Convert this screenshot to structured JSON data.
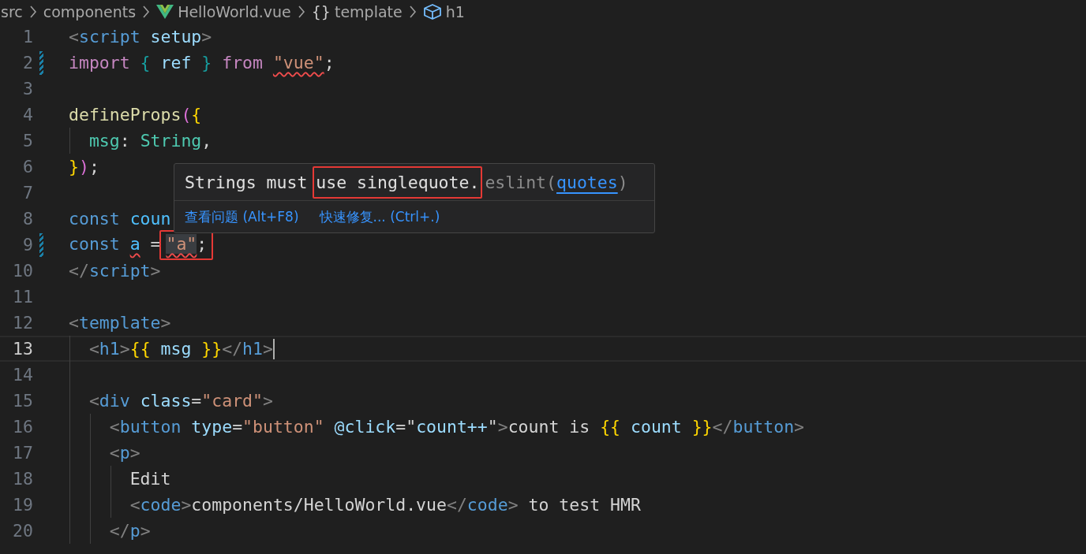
{
  "breadcrumbs": [
    {
      "label": "src",
      "kind": "folder"
    },
    {
      "label": "components",
      "kind": "folder"
    },
    {
      "label": "HelloWorld.vue",
      "kind": "vue-file"
    },
    {
      "label": "template",
      "kind": "namespace",
      "glyph": "{}"
    },
    {
      "label": "h1",
      "kind": "element"
    }
  ],
  "lines": [
    {
      "number": "1",
      "modified": false,
      "current": false,
      "segments": [
        {
          "text": "<",
          "kind": "punct"
        },
        {
          "text": "script ",
          "kind": "tag"
        },
        {
          "text": "setup",
          "kind": "attr"
        },
        {
          "text": ">",
          "kind": "punct"
        }
      ]
    },
    {
      "number": "2",
      "modified": true,
      "current": false,
      "segments": [
        {
          "text": "import ",
          "kind": "keyword"
        },
        {
          "text": "{",
          "kind": "brace2"
        },
        {
          "text": " ref ",
          "kind": "var"
        },
        {
          "text": "}",
          "kind": "brace2"
        },
        {
          "text": " from ",
          "kind": "keyword"
        },
        {
          "text": "\"vue\"",
          "kind": "string",
          "error": true
        },
        {
          "text": ";",
          "kind": "plain"
        }
      ]
    },
    {
      "number": "3",
      "modified": false,
      "current": false
    },
    {
      "number": "4",
      "modified": false,
      "current": false,
      "segments": [
        {
          "text": "defineProps",
          "kind": "fn"
        },
        {
          "text": "(",
          "kind": "paren"
        },
        {
          "text": "{",
          "kind": "brace"
        }
      ]
    },
    {
      "number": "5",
      "modified": false,
      "current": false,
      "segments": [
        {
          "text": "  msg",
          "kind": "type"
        },
        {
          "text": ": ",
          "kind": "plain"
        },
        {
          "text": "String",
          "kind": "type"
        },
        {
          "text": ",",
          "kind": "plain"
        }
      ]
    },
    {
      "number": "6",
      "modified": false,
      "current": false,
      "segments": [
        {
          "text": "}",
          "kind": "brace"
        },
        {
          "text": ")",
          "kind": "paren"
        },
        {
          "text": ";",
          "kind": "plain"
        }
      ]
    },
    {
      "number": "7",
      "modified": false,
      "current": false
    },
    {
      "number": "8",
      "modified": false,
      "current": false,
      "segments": [
        {
          "text": "const ",
          "kind": "decl"
        },
        {
          "text": "coun",
          "kind": "const"
        }
      ]
    },
    {
      "number": "9",
      "modified": true,
      "current": false,
      "segments": [
        {
          "text": "const ",
          "kind": "decl"
        },
        {
          "text": "a",
          "kind": "const",
          "error": true
        },
        {
          "text": " = ",
          "kind": "plain"
        },
        {
          "kind": "boxed",
          "children": [
            {
              "text": "\"a\"",
              "kind": "string",
              "error": true,
              "highlighted": true
            },
            {
              "text": ";",
              "kind": "plain"
            }
          ]
        }
      ]
    },
    {
      "number": "10",
      "modified": false,
      "current": false,
      "segments": [
        {
          "text": "</",
          "kind": "punct"
        },
        {
          "text": "script",
          "kind": "tag"
        },
        {
          "text": ">",
          "kind": "punct"
        }
      ]
    },
    {
      "number": "11",
      "modified": false,
      "current": false
    },
    {
      "number": "12",
      "modified": false,
      "current": false,
      "segments": [
        {
          "text": "<",
          "kind": "punct"
        },
        {
          "text": "template",
          "kind": "tag"
        },
        {
          "text": ">",
          "kind": "punct"
        }
      ]
    },
    {
      "number": "13",
      "modified": false,
      "current": true,
      "segments": [
        {
          "text": "  <",
          "kind": "punct"
        },
        {
          "text": "h1",
          "kind": "tag"
        },
        {
          "text": ">",
          "kind": "punct"
        },
        {
          "text": "{{",
          "kind": "brace"
        },
        {
          "text": " msg ",
          "kind": "var"
        },
        {
          "text": "}}",
          "kind": "brace"
        },
        {
          "text": "</",
          "kind": "punct"
        },
        {
          "text": "h1",
          "kind": "tag"
        },
        {
          "text": ">",
          "kind": "punct"
        }
      ]
    },
    {
      "number": "14",
      "modified": false,
      "current": false
    },
    {
      "number": "15",
      "modified": false,
      "current": false,
      "segments": [
        {
          "text": "  <",
          "kind": "punct"
        },
        {
          "text": "div ",
          "kind": "tag"
        },
        {
          "text": "class",
          "kind": "attr"
        },
        {
          "text": "=",
          "kind": "plain"
        },
        {
          "text": "\"card\"",
          "kind": "string"
        },
        {
          "text": ">",
          "kind": "punct"
        }
      ]
    },
    {
      "number": "16",
      "modified": false,
      "current": false,
      "segments": [
        {
          "text": "    <",
          "kind": "punct"
        },
        {
          "text": "button ",
          "kind": "tag"
        },
        {
          "text": "type",
          "kind": "attr"
        },
        {
          "text": "=",
          "kind": "plain"
        },
        {
          "text": "\"button\" ",
          "kind": "string"
        },
        {
          "text": "@click",
          "kind": "attr"
        },
        {
          "text": "=\"",
          "kind": "plain"
        },
        {
          "text": "count++",
          "kind": "var"
        },
        {
          "text": "\"",
          "kind": "plain"
        },
        {
          "text": ">",
          "kind": "punct"
        },
        {
          "text": "count is ",
          "kind": "plain"
        },
        {
          "text": "{{",
          "kind": "brace"
        },
        {
          "text": " count ",
          "kind": "var"
        },
        {
          "text": "}}",
          "kind": "brace"
        },
        {
          "text": "</",
          "kind": "punct"
        },
        {
          "text": "button",
          "kind": "tag"
        },
        {
          "text": ">",
          "kind": "punct"
        }
      ]
    },
    {
      "number": "17",
      "modified": false,
      "current": false,
      "segments": [
        {
          "text": "    <",
          "kind": "punct"
        },
        {
          "text": "p",
          "kind": "tag"
        },
        {
          "text": ">",
          "kind": "punct"
        }
      ]
    },
    {
      "number": "18",
      "modified": false,
      "current": false,
      "segments": [
        {
          "text": "      Edit",
          "kind": "plain"
        }
      ]
    },
    {
      "number": "19",
      "modified": false,
      "current": false,
      "segments": [
        {
          "text": "      <",
          "kind": "punct"
        },
        {
          "text": "code",
          "kind": "tag"
        },
        {
          "text": ">",
          "kind": "punct"
        },
        {
          "text": "components/HelloWorld.vue",
          "kind": "plain"
        },
        {
          "text": "</",
          "kind": "punct"
        },
        {
          "text": "code",
          "kind": "tag"
        },
        {
          "text": ">",
          "kind": "punct"
        },
        {
          "text": " to test HMR",
          "kind": "plain"
        }
      ]
    },
    {
      "number": "20",
      "modified": false,
      "current": false,
      "segments": [
        {
          "text": "    </",
          "kind": "punct"
        },
        {
          "text": "p",
          "kind": "tag"
        },
        {
          "text": ">",
          "kind": "punct"
        }
      ]
    }
  ],
  "hover": {
    "message": [
      {
        "text": "Strings must ",
        "kind": "plain"
      },
      {
        "text": "use singlequote.",
        "kind": "boxed"
      }
    ],
    "source": "eslint(",
    "rule": "quotes",
    "source_end": ")",
    "actions": [
      "查看问题 (Alt+F8)",
      "快速修复... (Ctrl+.)"
    ]
  }
}
